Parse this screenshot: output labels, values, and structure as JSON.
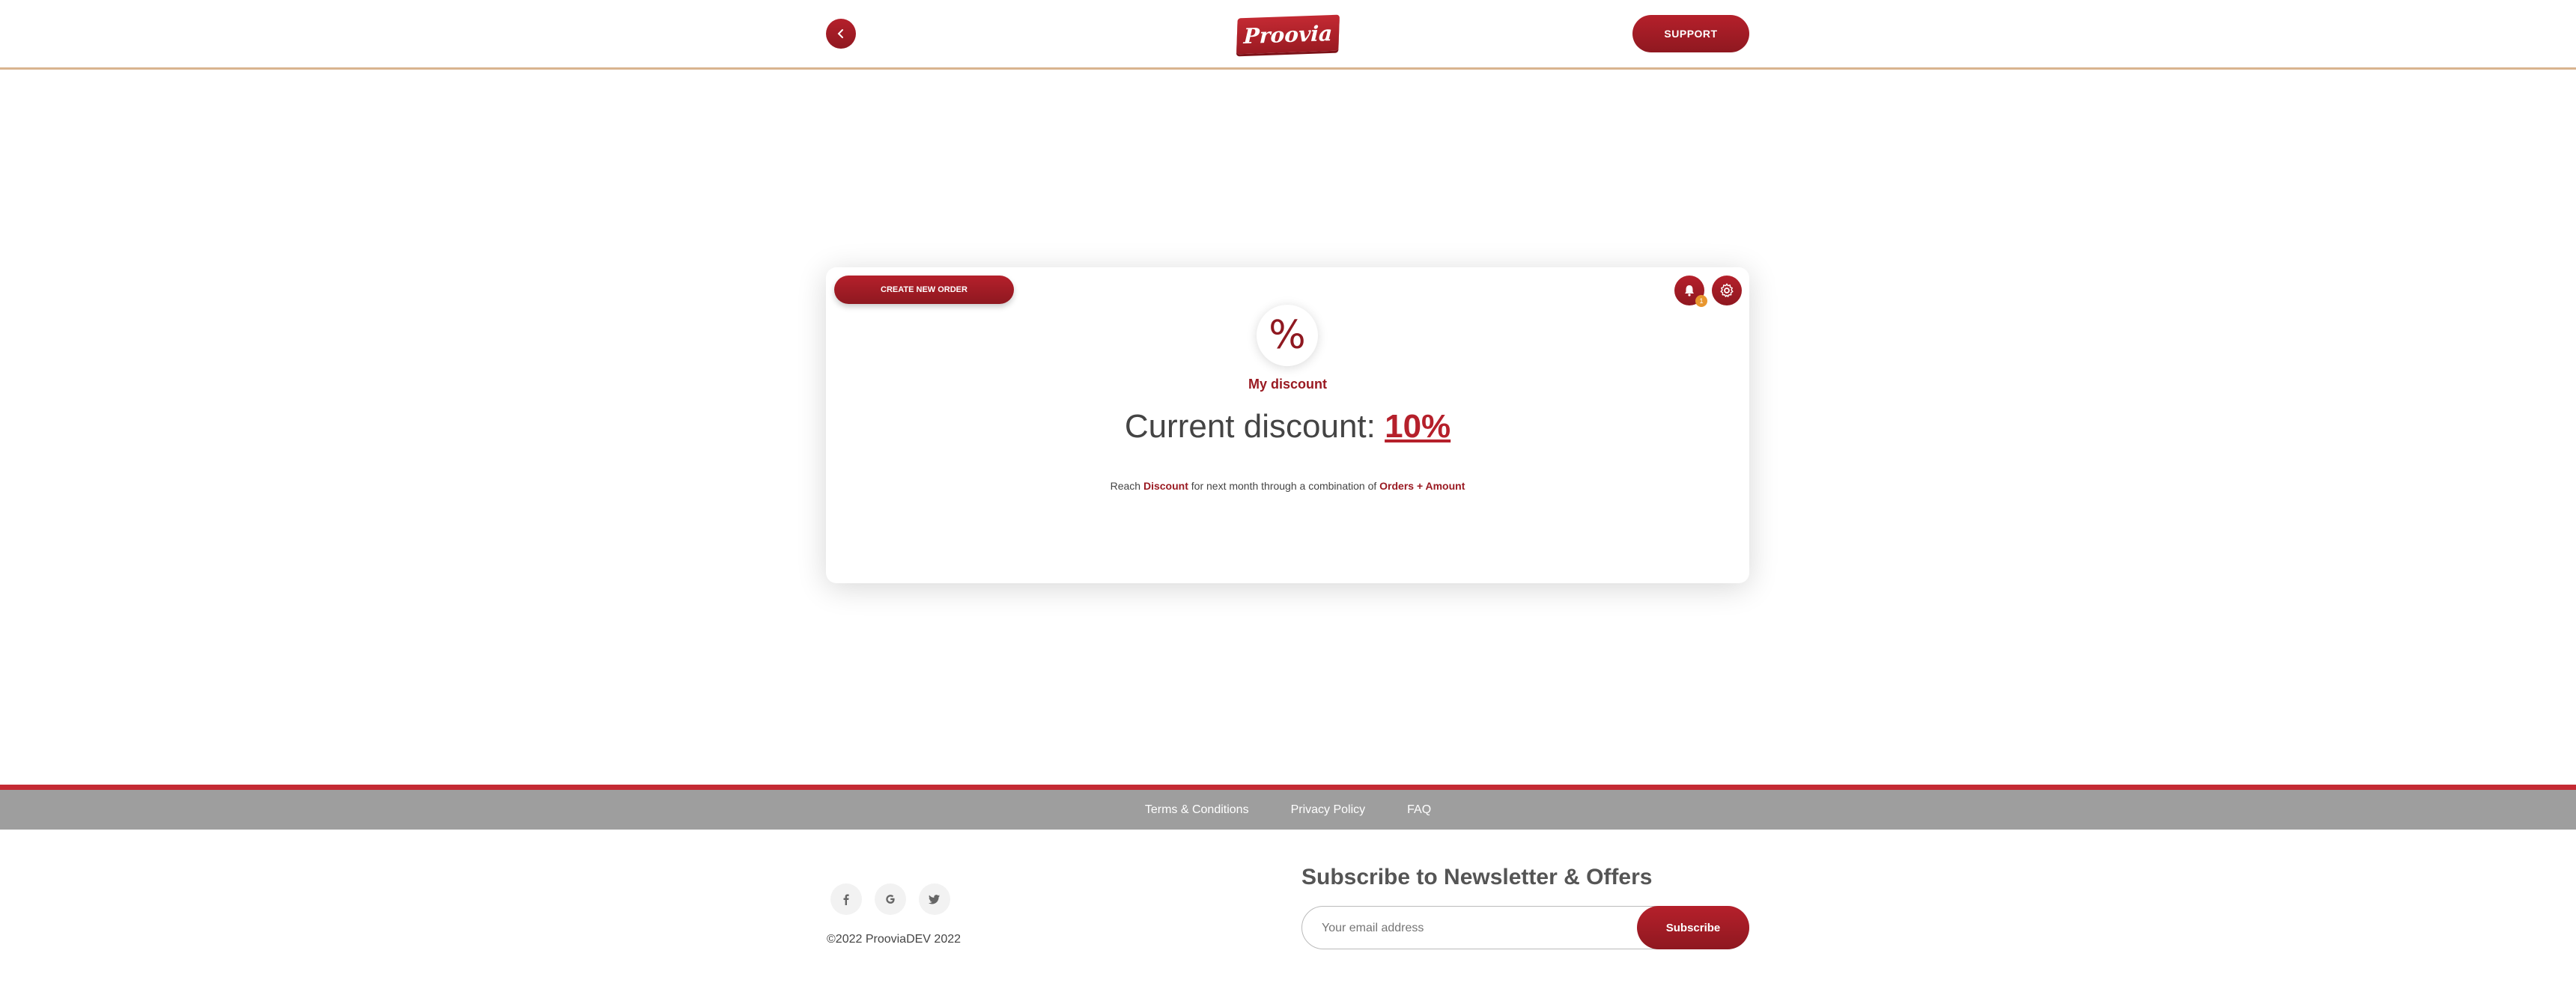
{
  "header": {
    "back_icon": "chevron-left-icon",
    "logo_text": "Proovia",
    "support_label": "SUPPORT"
  },
  "card": {
    "create_order_label": "CREATE NEW ORDER",
    "notification_icon": "bell-icon",
    "notification_count": "1",
    "settings_icon": "gear-icon",
    "percent_symbol": "%",
    "section_title": "My discount",
    "current_label": "Current discount:",
    "current_value": "10%",
    "reach_prefix": "Reach",
    "reach_discount": "Discount",
    "reach_middle": "for next month through a combination of",
    "reach_suffix": "Orders + Amount"
  },
  "footer": {
    "links": [
      "Terms & Conditions",
      "Privacy Policy",
      "FAQ"
    ],
    "social_icons": [
      "facebook-icon",
      "google-icon",
      "twitter-icon"
    ],
    "copyright": "©2022 ProoviaDEV 2022",
    "newsletter_title": "Subscribe to Newsletter & Offers",
    "email_placeholder": "Your email address",
    "subscribe_label": "Subscribe"
  },
  "colors": {
    "brand": "#b5202b",
    "brand_dark": "#8f1820",
    "badge": "#e8962f",
    "footer_bar": "#9e9e9e"
  }
}
